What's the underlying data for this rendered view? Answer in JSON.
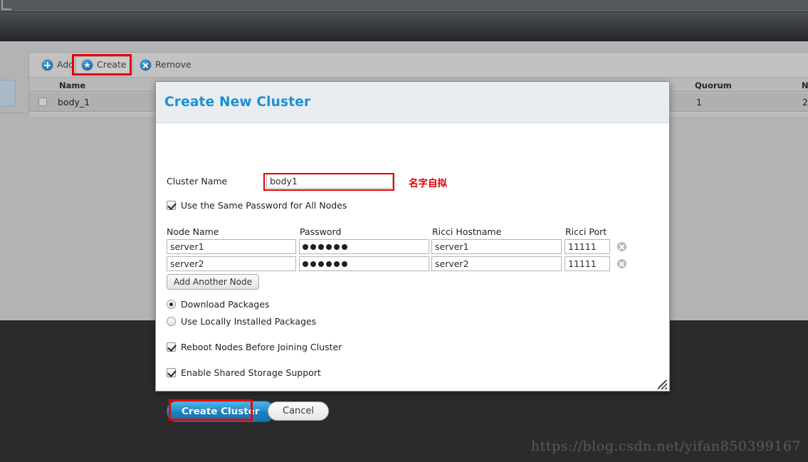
{
  "window": {
    "chrome_top_color": "#55585c"
  },
  "toolbar": {
    "add_label": "Add",
    "create_label": "Create",
    "remove_label": "Remove",
    "add_icon": "plus-circle-icon",
    "create_icon": "star-circle-icon",
    "remove_icon": "x-circle-icon"
  },
  "cluster_table": {
    "columns": [
      "Name",
      "Quorum",
      "N"
    ],
    "rows": [
      {
        "name": "body_1",
        "quorum": "1",
        "nodes": "2"
      }
    ]
  },
  "dialog": {
    "title": "Create New Cluster",
    "cluster_name": {
      "label": "Cluster Name",
      "value": "body1",
      "placeholder": ""
    },
    "annotation_cn": "名字自拟",
    "same_password": {
      "label": "Use the Same Password for All Nodes",
      "checked": true
    },
    "node_table": {
      "headers": [
        "Node Name",
        "Password",
        "Ricci Hostname",
        "Ricci Port"
      ],
      "rows": [
        {
          "node_name": "server1",
          "password_dots": 6,
          "ricci_hostname": "server1",
          "ricci_port": "11111"
        },
        {
          "node_name": "server2",
          "password_dots": 6,
          "ricci_hostname": "server2",
          "ricci_port": "11111"
        }
      ],
      "delete_icon": "remove-row-icon"
    },
    "add_node_label": "Add Another Node",
    "package_options": [
      {
        "label": "Download Packages",
        "selected": true
      },
      {
        "label": "Use Locally Installed Packages",
        "selected": false
      }
    ],
    "reboot_nodes": {
      "label": "Reboot Nodes Before Joining Cluster",
      "checked": true
    },
    "shared_storage": {
      "label": "Enable Shared Storage Support",
      "checked": true
    },
    "submit_label": "Create Cluster",
    "cancel_label": "Cancel",
    "accent_color": "#1b8fd4",
    "highlight_color": "#e60000"
  },
  "watermark": "https://blog.csdn.net/yifan850399167"
}
